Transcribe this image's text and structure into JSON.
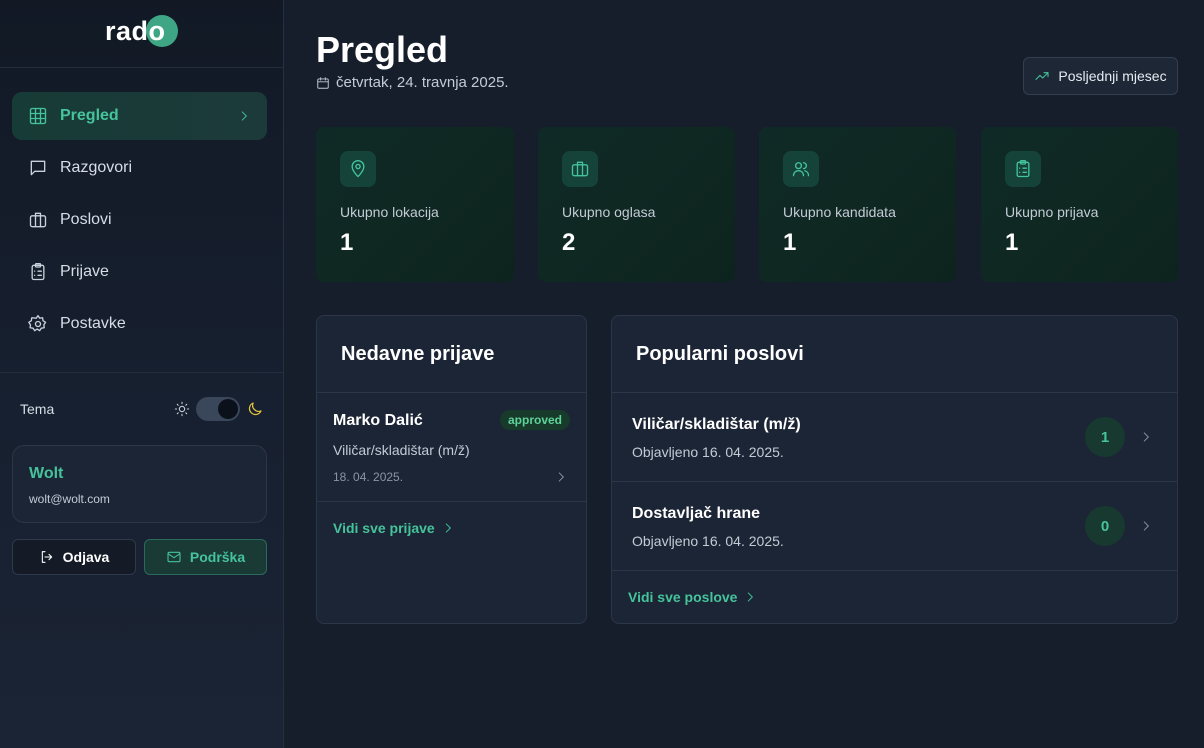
{
  "brand": {
    "logo_text": "rado",
    "accent": "#45c39b"
  },
  "sidebar": {
    "nav": [
      {
        "label": "Pregled",
        "icon": "grid-icon",
        "active": true
      },
      {
        "label": "Razgovori",
        "icon": "chat-icon"
      },
      {
        "label": "Poslovi",
        "icon": "briefcase-icon"
      },
      {
        "label": "Prijave",
        "icon": "clipboard-icon"
      },
      {
        "label": "Postavke",
        "icon": "gear-icon"
      }
    ],
    "theme_label": "Tema",
    "user": {
      "name": "Wolt",
      "email": "wolt@wolt.com"
    },
    "logout_label": "Odjava",
    "support_label": "Podrška"
  },
  "header": {
    "title": "Pregled",
    "date": "četvrtak, 24. travnja 2025.",
    "period_button": "Posljednji mjesec"
  },
  "stats": [
    {
      "label": "Ukupno lokacija",
      "value": "1",
      "icon": "map-pin-icon"
    },
    {
      "label": "Ukupno oglasa",
      "value": "2",
      "icon": "briefcase-icon"
    },
    {
      "label": "Ukupno kandidata",
      "value": "1",
      "icon": "users-icon"
    },
    {
      "label": "Ukupno prijava",
      "value": "1",
      "icon": "clipboard-list-icon"
    }
  ],
  "recent": {
    "title": "Nedavne prijave",
    "items": [
      {
        "name": "Marko Dalić",
        "status": "approved",
        "job": "Viličar/skladištar (m/ž)",
        "date": "18. 04. 2025."
      }
    ],
    "view_all": "Vidi sve prijave"
  },
  "popular": {
    "title": "Popularni poslovi",
    "items": [
      {
        "title": "Viličar/skladištar (m/ž)",
        "published": "Objavljeno 16. 04. 2025.",
        "count": "1"
      },
      {
        "title": "Dostavljač hrane",
        "published": "Objavljeno 16. 04. 2025.",
        "count": "0"
      }
    ],
    "view_all": "Vidi sve poslove"
  }
}
